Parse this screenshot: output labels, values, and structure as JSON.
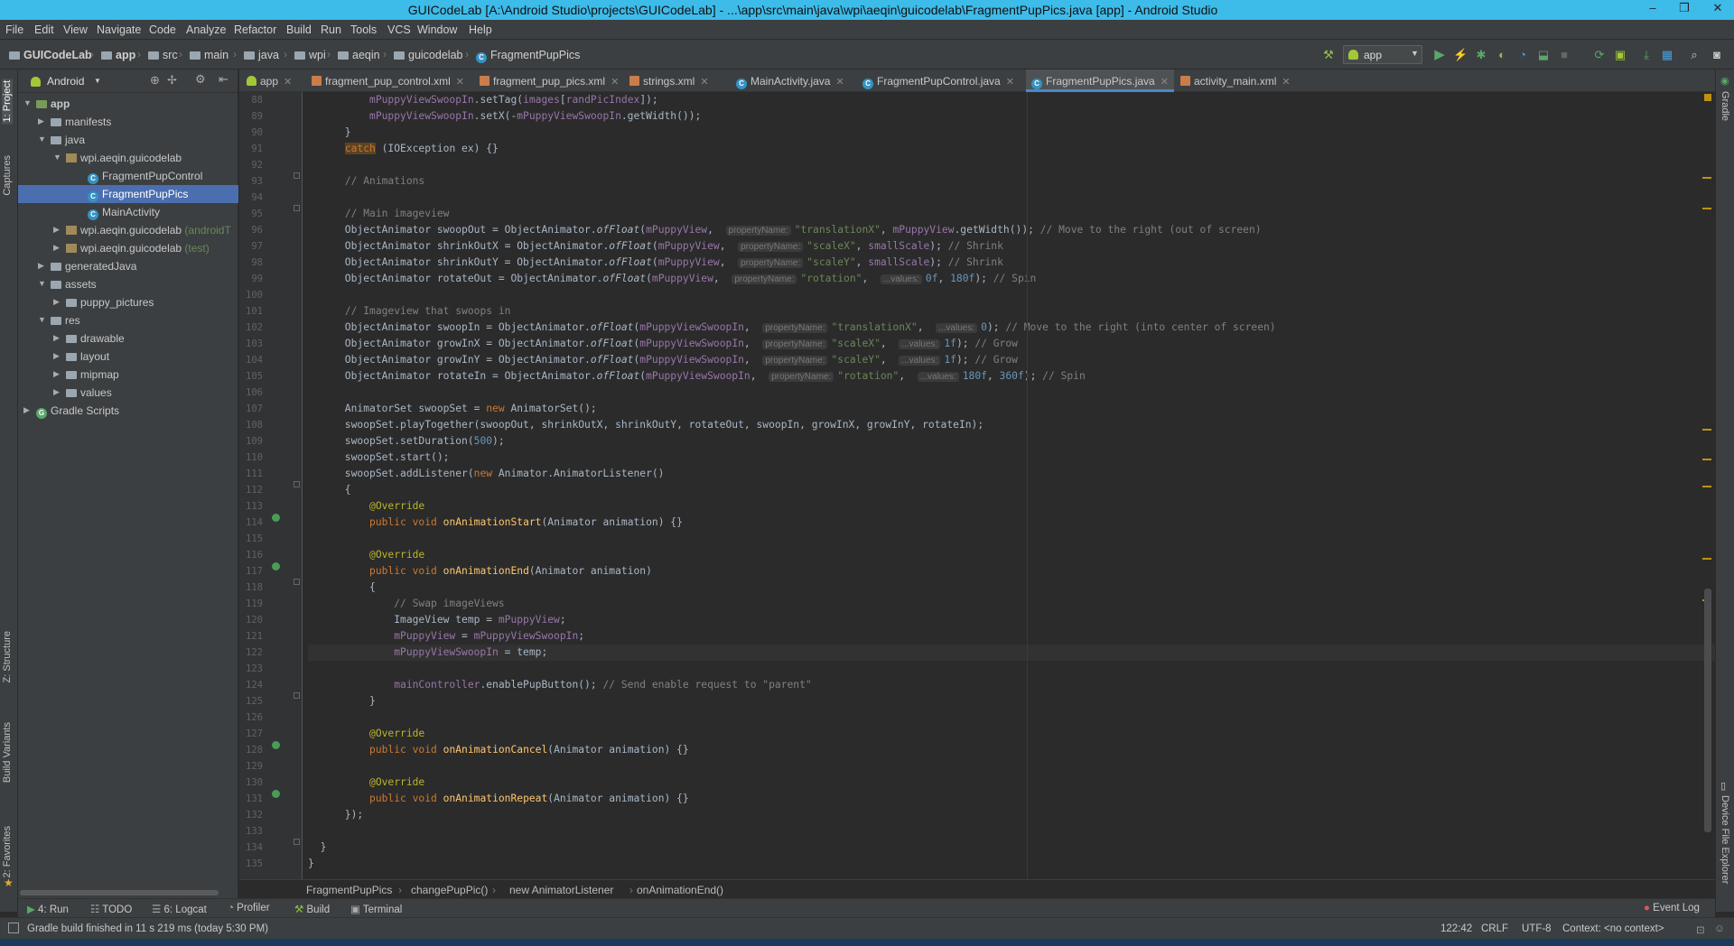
{
  "window": {
    "title": "GUICodeLab [A:\\Android Studio\\projects\\GUICodeLab] - ...\\app\\src\\main\\java\\wpi\\aeqin\\guicodelab\\FragmentPupPics.java [app] - Android Studio",
    "minimize": "–",
    "maximize": "❐",
    "close": "✕"
  },
  "menu": [
    "File",
    "Edit",
    "View",
    "Navigate",
    "Code",
    "Analyze",
    "Refactor",
    "Build",
    "Run",
    "Tools",
    "VCS",
    "Window",
    "Help"
  ],
  "nav": {
    "crumbs": [
      "GUICodeLab",
      "app",
      "src",
      "main",
      "java",
      "wpi",
      "aeqin",
      "guicodelab",
      "FragmentPupPics"
    ],
    "run_config": "app"
  },
  "colors": {
    "titlebar": "#3dbbe9",
    "accent": "#4a88c7",
    "selected": "#4b6eaf"
  },
  "left_strip": {
    "project": "1: Project",
    "captures": "Captures",
    "structure": "Z: Structure",
    "build_variants": "Build Variants",
    "favorites": "2: Favorites"
  },
  "right_strip": {
    "gradle": "Gradle",
    "device_explorer": "Device File Explorer"
  },
  "project": {
    "view_mode": "Android",
    "tree": [
      {
        "label": "app",
        "extra": ""
      },
      {
        "label": "manifests",
        "extra": ""
      },
      {
        "label": "java",
        "extra": ""
      },
      {
        "label": "wpi.aeqin.guicodelab",
        "extra": ""
      },
      {
        "label": "FragmentPupControl",
        "extra": ""
      },
      {
        "label": "FragmentPupPics",
        "extra": ""
      },
      {
        "label": "MainActivity",
        "extra": ""
      },
      {
        "label": "wpi.aeqin.guicodelab",
        "extra": " (androidT"
      },
      {
        "label": "wpi.aeqin.guicodelab",
        "extra": " (test)"
      },
      {
        "label": "generatedJava",
        "extra": ""
      },
      {
        "label": "assets",
        "extra": ""
      },
      {
        "label": "puppy_pictures",
        "extra": ""
      },
      {
        "label": "res",
        "extra": ""
      },
      {
        "label": "drawable",
        "extra": ""
      },
      {
        "label": "layout",
        "extra": ""
      },
      {
        "label": "mipmap",
        "extra": ""
      },
      {
        "label": "values",
        "extra": ""
      },
      {
        "label": "Gradle Scripts",
        "extra": ""
      }
    ]
  },
  "tabs": [
    "app",
    "fragment_pup_control.xml",
    "fragment_pup_pics.xml",
    "strings.xml",
    "MainActivity.java",
    "FragmentPupControl.java",
    "FragmentPupPics.java",
    "activity_main.xml"
  ],
  "editor": {
    "line_numbers": [
      "88",
      "89",
      "90",
      "91",
      "92",
      "93",
      "94",
      "95",
      "96",
      "97",
      "98",
      "99",
      "100",
      "101",
      "102",
      "103",
      "104",
      "105",
      "106",
      "107",
      "108",
      "109",
      "110",
      "111",
      "112",
      "113",
      "114",
      "115",
      "116",
      "117",
      "118",
      "119",
      "120",
      "121",
      "122",
      "123",
      "124",
      "125",
      "126",
      "127",
      "128",
      "129",
      "130",
      "131",
      "132",
      "133",
      "134",
      "135"
    ],
    "hints": {
      "property": "propertyName:",
      "values": "...values:"
    }
  },
  "breadcrumb": [
    "FragmentPupPics",
    "changePupPic()",
    "new AnimatorListener",
    "onAnimationEnd()"
  ],
  "toolwindows": {
    "run": "4: Run",
    "todo": "TODO",
    "logcat": "6: Logcat",
    "profiler": "Profiler",
    "build": "Build",
    "terminal": "Terminal",
    "event_log": "Event Log"
  },
  "status": {
    "message": "Gradle build finished in 11 s 219 ms (today 5:30 PM)",
    "position": "122:42",
    "line_sep": "CRLF",
    "encoding": "UTF-8",
    "context": "Context: <no context>"
  }
}
